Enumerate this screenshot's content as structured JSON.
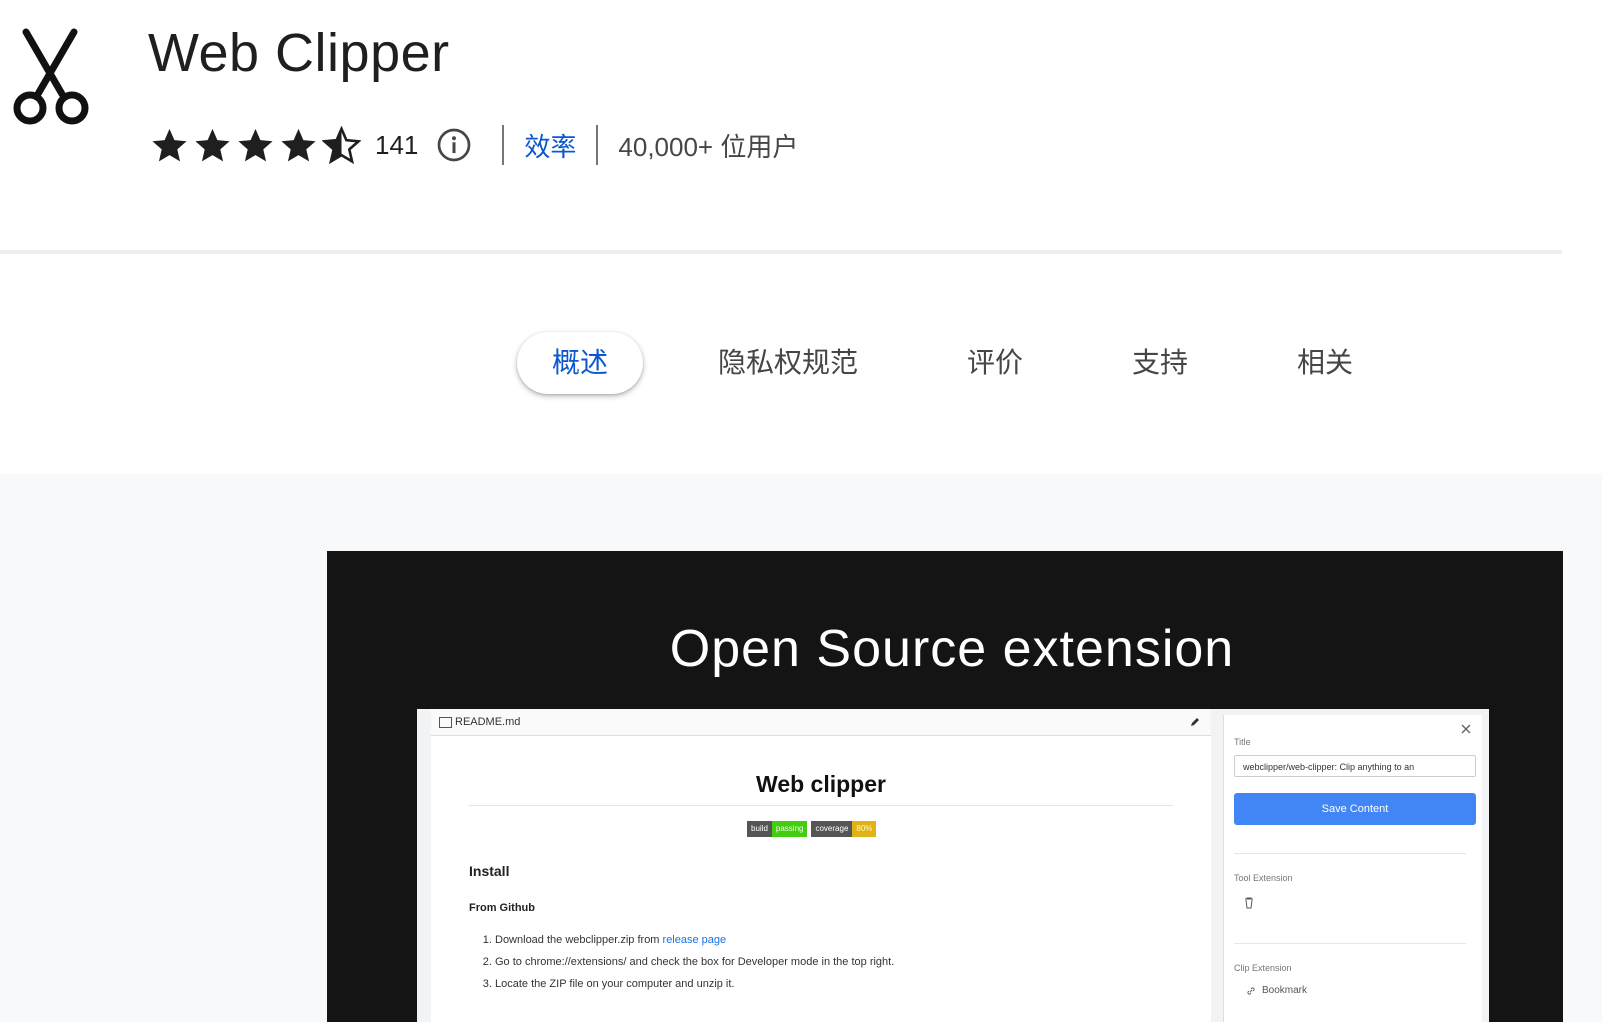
{
  "header": {
    "title": "Web Clipper",
    "rating": 4.5,
    "rating_count": "141",
    "category": "效率",
    "users": "40,000+ 位用户"
  },
  "tabs": [
    {
      "label": "概述",
      "active": true
    },
    {
      "label": "隐私权规范",
      "active": false
    },
    {
      "label": "评价",
      "active": false
    },
    {
      "label": "支持",
      "active": false
    },
    {
      "label": "相关",
      "active": false
    }
  ],
  "slide": {
    "heading": "Open Source extension",
    "readme": {
      "filename": "README.md",
      "title": "Web clipper",
      "badges": [
        {
          "left": "build",
          "right": "passing"
        },
        {
          "left": "coverage",
          "right": "80%"
        }
      ],
      "install_heading": "Install",
      "from_github": "From Github",
      "steps": {
        "step1_prefix": "Download the webclipper.zip from ",
        "step1_link": "release page",
        "step2": "Go to chrome://extensions/ and check the box for Developer mode in the top right.",
        "step3": "Locate the ZIP file on your computer and unzip it."
      }
    },
    "panel": {
      "title_label": "Title",
      "title_value": "webclipper/web-clipper: Clip anything to an",
      "save_button": "Save Content",
      "tool_extension_label": "Tool Extension",
      "clip_extension_label": "Clip Extension",
      "bookmark_label": "Bookmark"
    }
  },
  "colors": {
    "accent": "#0b57d0",
    "save_button": "#4285f4",
    "slide_bg": "#141414",
    "gallery_bg": "#f8f9fa"
  }
}
